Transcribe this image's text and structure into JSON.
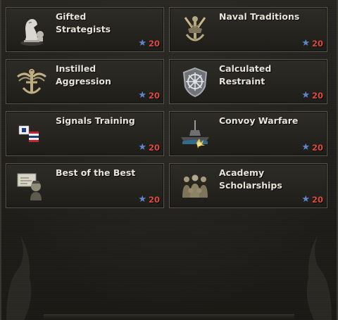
{
  "colors": {
    "cost_text": "#e04a3a",
    "star": "#5f86c8",
    "title_text": "#e8e4da",
    "card_border": "#5a554b"
  },
  "cards": [
    {
      "title": "Gifted\nStrategists",
      "cost": "20",
      "icon": "chess-knight-icon"
    },
    {
      "title": "Naval Traditions",
      "cost": "20",
      "icon": "anchor-sword-icon"
    },
    {
      "title": "Instilled\nAggression",
      "cost": "20",
      "icon": "anchor-eagle-icon"
    },
    {
      "title": "Calculated\nRestraint",
      "cost": "20",
      "icon": "ship-wheel-shield-icon"
    },
    {
      "title": "Signals Training",
      "cost": "20",
      "icon": "signal-flags-icon"
    },
    {
      "title": "Convoy Warfare",
      "cost": "20",
      "icon": "submarine-explosion-icon"
    },
    {
      "title": "Best of the Best",
      "cost": "20",
      "icon": "officer-portrait-icon"
    },
    {
      "title": "Academy\nScholarships",
      "cost": "20",
      "icon": "cadets-group-icon"
    }
  ]
}
